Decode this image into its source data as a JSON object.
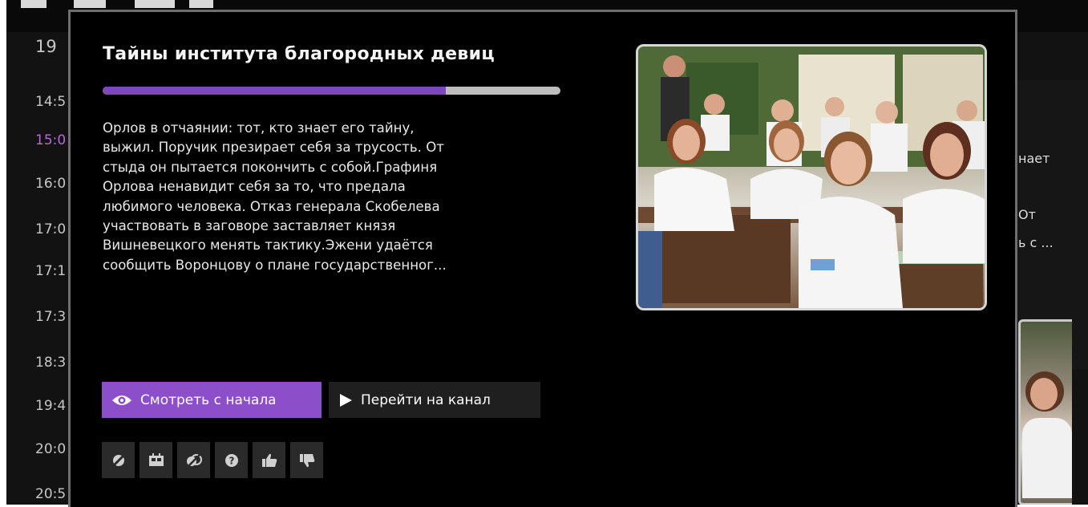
{
  "background_epg": {
    "times": [
      "19",
      "14:5",
      "15:0",
      "16:0",
      "17:0",
      "17:1",
      "17:3",
      "18:3",
      "19:4",
      "20:0",
      "20:5"
    ],
    "active_index": 2,
    "right_text": [
      "нает",
      "От",
      "ь с ..."
    ]
  },
  "popup": {
    "title": "Тайны института благородных девиц",
    "progress_fraction": 0.75,
    "description": "Орлов в отчаянии: тот, кто знает его тайну,\nвыжил. Поручик презирает себя за трусость. От\nстыда он пытается покончить с собой.Графиня\nОрлова ненавидит себя за то, что предала\nлюбимого человека. Отказ генерала Скобелева\nучаствовать в заговоре заставляет князя\nВишневецкого менять тактику.Эжени удаётся\nсообщить Воронцову о плане государственног...",
    "buttons": {
      "watch_from_start": "Смотреть с начала",
      "go_to_channel": "Перейти на канал"
    },
    "icon_buttons": [
      "no-record-icon",
      "reminder-icon",
      "series-record-icon",
      "help-icon",
      "thumbs-up-icon",
      "thumbs-down-icon"
    ]
  },
  "colors": {
    "accent": "#8d4fc9",
    "progress_fill": "#7f46c2",
    "active_time": "#b56ad6"
  }
}
